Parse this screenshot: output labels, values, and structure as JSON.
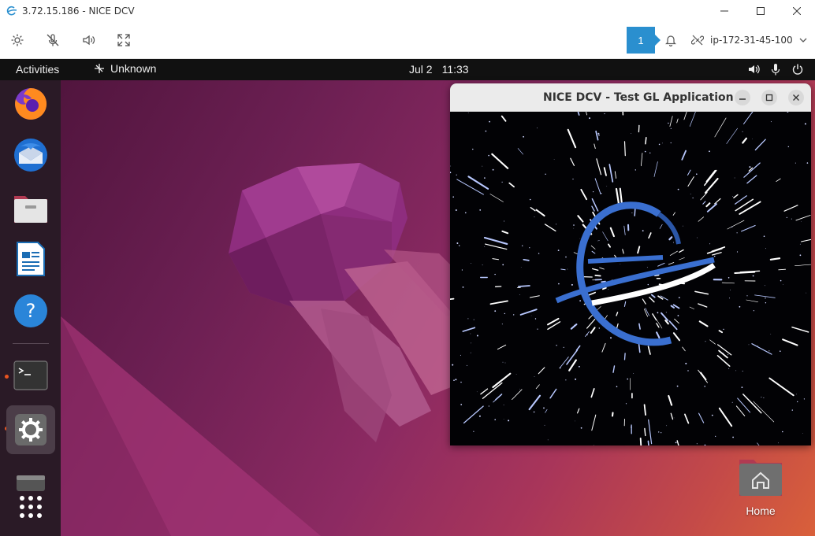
{
  "window": {
    "title": "3.72.15.186 - NICE DCV",
    "minimize_icon": "minimize-icon",
    "maximize_icon": "maximize-icon",
    "close_icon": "close-icon"
  },
  "toolbar": {
    "notification_count": "1",
    "host": "ip-172-31-45-100"
  },
  "topbar": {
    "activities": "Activities",
    "app_name": "Unknown",
    "date": "Jul 2",
    "time": "11:33"
  },
  "gl_window": {
    "title": "NICE DCV - Test GL Application"
  },
  "desktop": {
    "home_label": "Home"
  },
  "colors": {
    "accent_blue": "#2a8fcf",
    "ubuntu_orange": "#e95420",
    "logo_blue": "#3a6fd0"
  }
}
